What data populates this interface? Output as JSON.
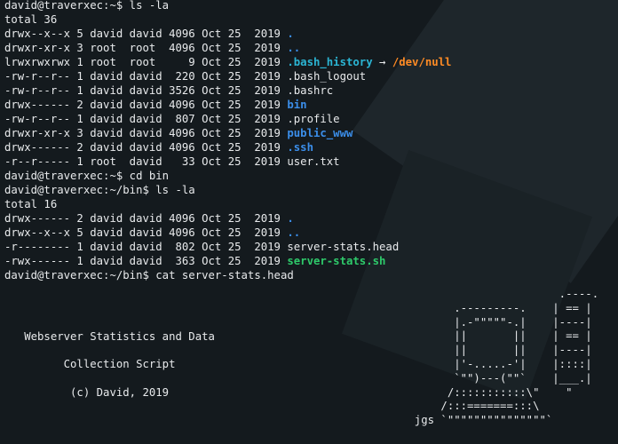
{
  "colors": {
    "background": "#141a1e",
    "directory": "#3b8eea",
    "symlink": "#2bb5d4",
    "symlink_target": "#ff8b24",
    "executable": "#2ec96a"
  },
  "terminal": {
    "lines": [
      {
        "kind": "prompt",
        "text": "david@traverxec:~$ ls -la"
      },
      {
        "kind": "text",
        "text": "total 36"
      },
      {
        "kind": "entry",
        "meta": "drwx--x--x 5 david david 4096 Oct 25  2019 ",
        "name": ".",
        "style": "dir"
      },
      {
        "kind": "entry",
        "meta": "drwxr-xr-x 3 root  root  4096 Oct 25  2019 ",
        "name": "..",
        "style": "dir"
      },
      {
        "kind": "symlink",
        "meta": "lrwxrwxrwx 1 root  root     9 Oct 25  2019 ",
        "name": ".bash_history",
        "arrow": " → ",
        "target": "/dev/null"
      },
      {
        "kind": "entry",
        "meta": "-rw-r--r-- 1 david david  220 Oct 25  2019 ",
        "name": ".bash_logout",
        "style": "plain"
      },
      {
        "kind": "entry",
        "meta": "-rw-r--r-- 1 david david 3526 Oct 25  2019 ",
        "name": ".bashrc",
        "style": "plain"
      },
      {
        "kind": "entry",
        "meta": "drwx------ 2 david david 4096 Oct 25  2019 ",
        "name": "bin",
        "style": "dir"
      },
      {
        "kind": "entry",
        "meta": "-rw-r--r-- 1 david david  807 Oct 25  2019 ",
        "name": ".profile",
        "style": "plain"
      },
      {
        "kind": "entry",
        "meta": "drwxr-xr-x 3 david david 4096 Oct 25  2019 ",
        "name": "public_www",
        "style": "dir"
      },
      {
        "kind": "entry",
        "meta": "drwx------ 2 david david 4096 Oct 25  2019 ",
        "name": ".ssh",
        "style": "dir"
      },
      {
        "kind": "entry",
        "meta": "-r--r----- 1 root  david   33 Oct 25  2019 ",
        "name": "user.txt",
        "style": "plain"
      },
      {
        "kind": "prompt",
        "text": "david@traverxec:~$ cd bin"
      },
      {
        "kind": "prompt",
        "text": "david@traverxec:~/bin$ ls -la"
      },
      {
        "kind": "text",
        "text": "total 16"
      },
      {
        "kind": "entry",
        "meta": "drwx------ 2 david david 4096 Oct 25  2019 ",
        "name": ".",
        "style": "dir"
      },
      {
        "kind": "entry",
        "meta": "drwx--x--x 5 david david 4096 Oct 25  2019 ",
        "name": "..",
        "style": "dir"
      },
      {
        "kind": "entry",
        "meta": "-r-------- 1 david david  802 Oct 25  2019 ",
        "name": "server-stats.head",
        "style": "plain"
      },
      {
        "kind": "entry",
        "meta": "-rwx------ 1 david david  363 Oct 25  2019 ",
        "name": "server-stats.sh",
        "style": "exec"
      },
      {
        "kind": "prompt",
        "text": "david@traverxec:~/bin$ cat server-stats.head"
      }
    ]
  },
  "banner": {
    "line1": "   Webserver Statistics and Data",
    "line2": "         Collection Script",
    "line3": "          (c) David, 2019"
  },
  "ascii_art": {
    "lines": [
      "                        .----.",
      "        .---------.    | == |",
      "        |.-\"\"\"\"\"-.|    |----|",
      "        ||       ||    | == |",
      "        ||       ||    |----|",
      "        |'-.....-'|    |::::|",
      "        `\"\")---(\"\"`    |___.|",
      "       /:::::::::::\\\"    \"",
      "      /:::=======:::\\",
      "  jgs `\"\"\"\"\"\"\"\"\"\"\"\"\"\"\"`"
    ]
  }
}
